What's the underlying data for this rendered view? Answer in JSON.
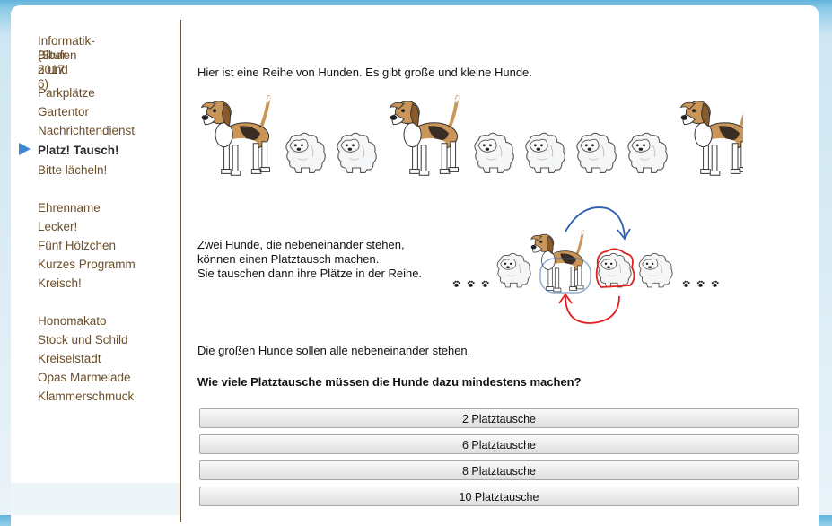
{
  "sidebar": {
    "title_line1": "Informatik-Biber 2017",
    "title_line2": "(Stufen 5 und 6)",
    "group1": [
      "Parkplätze",
      "Gartentor",
      "Nachrichtendienst",
      "Platz! Tausch!",
      "Bitte lächeln!"
    ],
    "group2": [
      "Ehrenname",
      "Lecker!",
      "Fünf Hölzchen",
      "Kurzes Programm",
      "Kreisch!"
    ],
    "group3": [
      "Honomakato",
      "Stock und Schild",
      "Kreiselstadt",
      "Opas Marmelade",
      "Klammerschmuck"
    ],
    "active": "Platz! Tausch!"
  },
  "main": {
    "intro": "Hier ist eine Reihe von Hunden. Es gibt große und kleine Hunde.",
    "dog_row": [
      "big",
      "small",
      "small",
      "big",
      "small",
      "small",
      "small",
      "small",
      "big"
    ],
    "swap_line1": "Zwei Hunde, die nebeneinander stehen,",
    "swap_line2": "können einen Platztausch machen.",
    "swap_line3": "Sie tauschen dann ihre Plätze in der Reihe.",
    "goal": "Die großen Hunde sollen alle nebeneinander stehen.",
    "question": "Wie viele Platztausche müssen die Hunde dazu mindestens machen?"
  },
  "answers": [
    "2 Platztausche",
    "6 Platztausche",
    "8 Platztausche",
    "10 Platztausche"
  ],
  "colors": {
    "nav_text": "#6b4f2a",
    "active_arrow": "#3f86d8",
    "swap_arrow_top": "#2a5fb0",
    "swap_arrow_bottom": "#e02020"
  }
}
